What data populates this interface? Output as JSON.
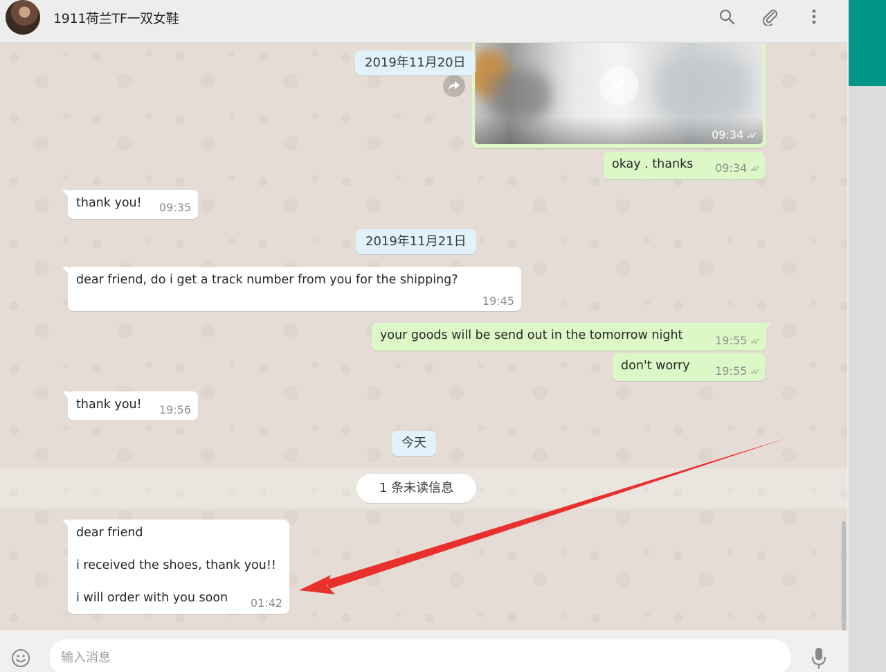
{
  "header": {
    "contact_name": "1911荷兰TF一双女鞋"
  },
  "dates": {
    "day1": "2019年11月20日",
    "day2": "2019年11月21日",
    "today": "今天"
  },
  "image_message": {
    "time": "09:34"
  },
  "messages": [
    {
      "direction": "out",
      "text": "okay . thanks",
      "time": "09:34"
    },
    {
      "direction": "in",
      "text": "thank you!",
      "time": "09:35"
    },
    {
      "direction": "in",
      "text": "dear friend, do i get a track number from you for the shipping?",
      "time": "19:45"
    },
    {
      "direction": "out",
      "text": "your goods will be send out in the tomorrow night",
      "time": "19:55"
    },
    {
      "direction": "out",
      "text": "don't worry",
      "time": "19:55"
    },
    {
      "direction": "in",
      "text": "thank you!",
      "time": "19:56"
    }
  ],
  "unread": {
    "label": "1 条未读信息"
  },
  "last_message": {
    "lines": [
      "dear friend",
      "i received the shoes, thank you!!",
      "i will order with you soon"
    ],
    "time": "01:42"
  },
  "composer": {
    "placeholder": "输入消息"
  },
  "colors": {
    "incoming_bubble": "#ffffff",
    "outgoing_bubble": "#dcf8c6",
    "chat_background": "#e5ddd5",
    "accent": "#009688",
    "annotation_arrow": "#e8302c"
  },
  "icons": {
    "header": [
      "search-icon",
      "attach-icon",
      "menu-icon"
    ],
    "footer": [
      "emoji-icon",
      "mic-icon"
    ],
    "image": [
      "cancel-download-icon",
      "forward-icon"
    ]
  }
}
